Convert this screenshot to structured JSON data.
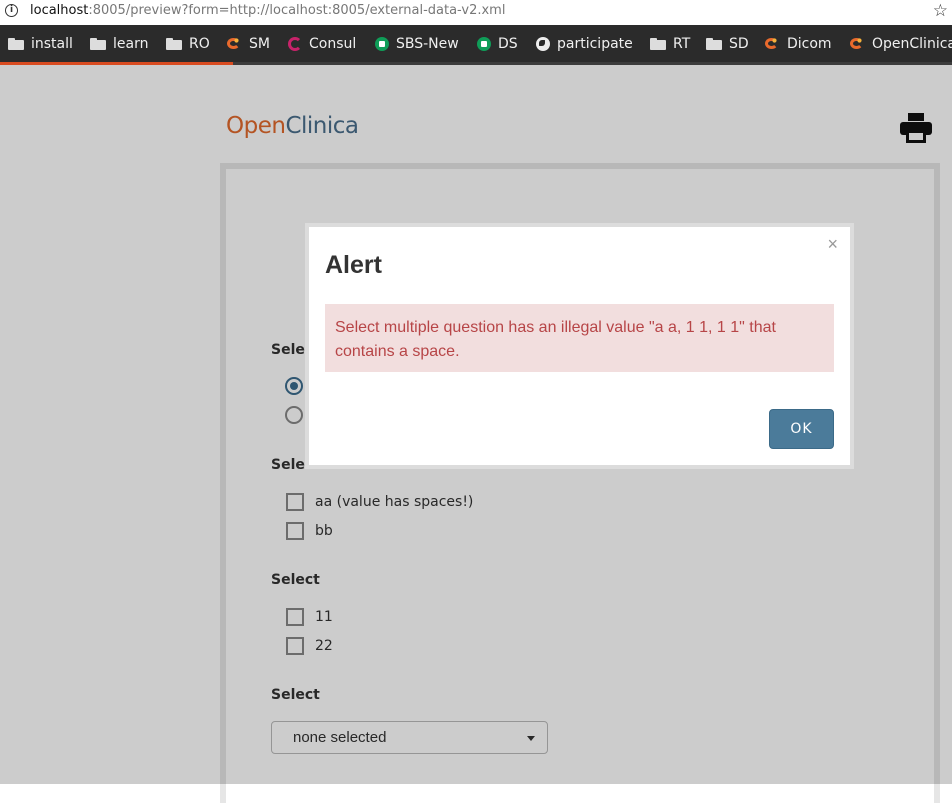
{
  "browser": {
    "url_host": "localhost",
    "url_rest": ":8005/preview?form=http://localhost:8005/external-data-v2.xml",
    "star_icon": "star-icon"
  },
  "bookmarks": [
    {
      "label": "install",
      "icon": "folder"
    },
    {
      "label": "learn",
      "icon": "folder"
    },
    {
      "label": "RO",
      "icon": "folder"
    },
    {
      "label": "SM",
      "icon": "openclinica"
    },
    {
      "label": "Consul",
      "icon": "consul"
    },
    {
      "label": "SBS-New",
      "icon": "meet"
    },
    {
      "label": "DS",
      "icon": "meet"
    },
    {
      "label": "participate",
      "icon": "globe"
    },
    {
      "label": "RT",
      "icon": "folder"
    },
    {
      "label": "SD",
      "icon": "folder"
    },
    {
      "label": "Dicom",
      "icon": "openclinica"
    },
    {
      "label": "OpenClinica",
      "icon": "openclinica"
    }
  ],
  "page_load_progress": 0.245,
  "header": {
    "logo_open": "Open",
    "logo_clinica": "Clinica",
    "print_icon": "printer-icon"
  },
  "form": {
    "q1_label": "Selec",
    "q2_label": "Select",
    "q2_options": [
      "aa (value has spaces!)",
      "bb"
    ],
    "q3_label": "Select",
    "q3_options": [
      "11",
      "22"
    ],
    "q4_label": "Select",
    "q4_select_value": "none selected"
  },
  "modal": {
    "title": "Alert",
    "close": "×",
    "message": "Select multiple question has an illegal value \"a a, 1 1, 1 1\" that contains a space.",
    "ok_label": "OK"
  }
}
